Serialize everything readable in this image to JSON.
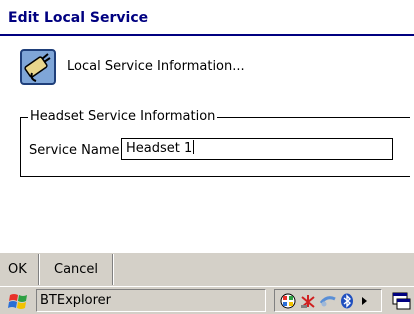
{
  "window": {
    "title": "Edit Local Service"
  },
  "main": {
    "info_text": "Local Service Information...",
    "group_label": "Headset Service Information",
    "service_name_label": "Service Name",
    "service_name_value": "Headset 1"
  },
  "softkeys": {
    "ok": "OK",
    "cancel": "Cancel"
  },
  "taskbar": {
    "app_name": "BTExplorer",
    "tray_icons": [
      "network-icon",
      "antenna-icon",
      "connection-icon",
      "bluetooth-icon",
      "arrow-right-icon"
    ],
    "desktop_icon": "desktop-icon"
  },
  "colors": {
    "title": "#000080",
    "bar_bg": "#d4d0c8"
  }
}
